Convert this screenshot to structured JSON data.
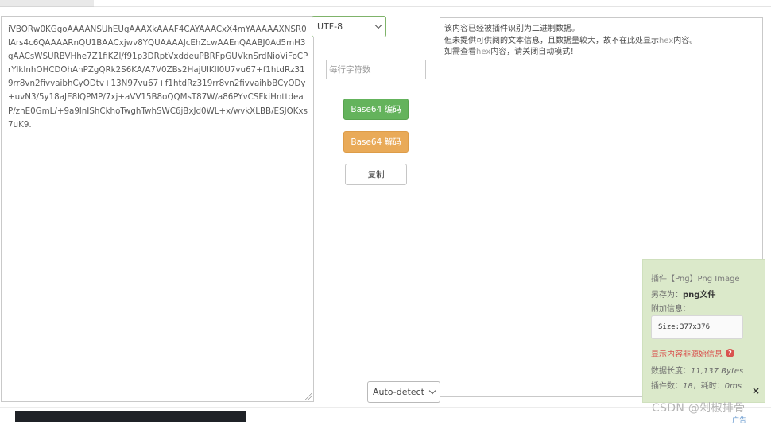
{
  "input_text": "iVBORw0KGgoAAAANSUhEUgAAAXkAAAF4CAYAAACxX4mYAAAAAXNSR0lArs4c6QAAAARnQU1BAACxjwv8YQUAAAAJcEhZcwAAEnQAABJ0Ad5mH3gAACsWSURBVHhe7Z1fiKZl/f91p3DRptVxddeuPBRFpGUVknSrdNioViFoCPrYlkInhOHCDOhAhPZgQRk2S6KA/A7V0ZBs2HajUlKII0U7vu67+f1htdRz319rr8vn2fivvaibhCyODtv+13N97vu67+f1htdRz319rr8vn2fivvaihbBCyODy+uvN3/5y18aJE8lQPMP/7xj+aVV15B8oQQMsT87W/a86PYvCSFkiHnttdeaP/zhE0GmL/+9a9lnIShCkhoTwghTwhSWC6jBxJd0WL+x/wvkXLBB/ESJOKxs7uK9.",
  "encoding_select": "UTF-8",
  "char_count_placeholder": "每行字符数",
  "encode_label": "Base64 编码",
  "decode_label": "Base64 解码",
  "copy_label": "复制",
  "auto_detect_select": "Auto-detect",
  "output": {
    "line1": "该内容已经被插件识别为二进制数据。",
    "line2_pre": "但未提供可供阅的文本信息，且数据量较大，故不在此处显示",
    "line2_hex": "hex",
    "line2_post": "内容。",
    "line3_pre": "如需查看",
    "line3_hex": "hex",
    "line3_post": "内容，请关闭自动模式！"
  },
  "plugin_panel": {
    "title": "插件【Png】Png Image",
    "saveas_label": "另存为：",
    "saveas_value": "png文件",
    "additional_label": "附加信息：",
    "size_text": "Size:377x376",
    "warning": "显示内容非源始信息",
    "length_label": "数据长度：",
    "length_value": "11,137 Bytes",
    "count_label": "插件数：",
    "count_value": "18",
    "time_label": "耗时：",
    "time_value": "0ms",
    "close_symbol": "×"
  },
  "watermark": "CSDN @剁椒排骨",
  "ad_text": "广告"
}
